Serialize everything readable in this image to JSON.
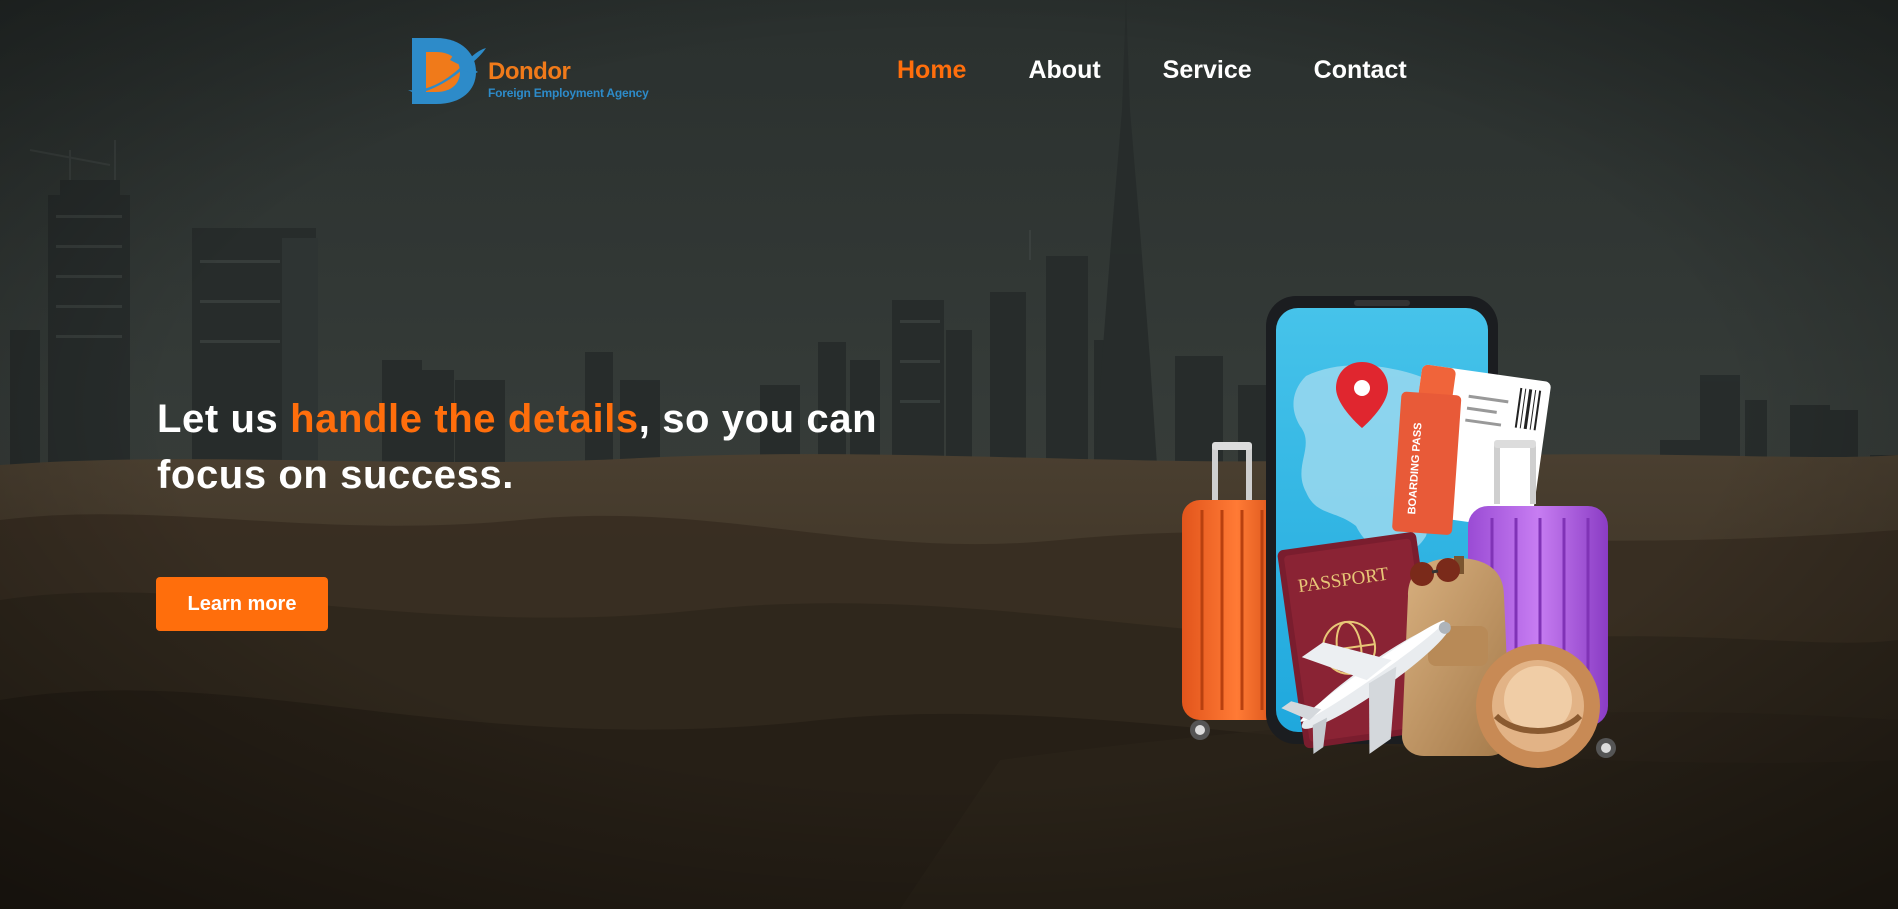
{
  "brand": {
    "name": "Dondor",
    "tagline": "Foreign Employment Agency",
    "logo_icon": "airplane-d-logo",
    "colors": {
      "orange": "#f07a1a",
      "blue": "#2d8bc9"
    }
  },
  "nav": {
    "active": "Home",
    "items": [
      {
        "label": "Home"
      },
      {
        "label": "About"
      },
      {
        "label": "Service"
      },
      {
        "label": "Contact"
      }
    ]
  },
  "hero": {
    "headline_before": "Let us ",
    "headline_accent": "handle the details",
    "headline_after": ", so you can focus on success.",
    "cta_label": "Learn more",
    "background": "desert-city-skyline",
    "illustration": {
      "icon": "travel-items-illustration",
      "passport_text": "PASSPORT",
      "boarding_pass_text": "BOARDING PASS"
    }
  },
  "theme": {
    "accent": "#ff6e0c",
    "text": "#ffffff"
  }
}
